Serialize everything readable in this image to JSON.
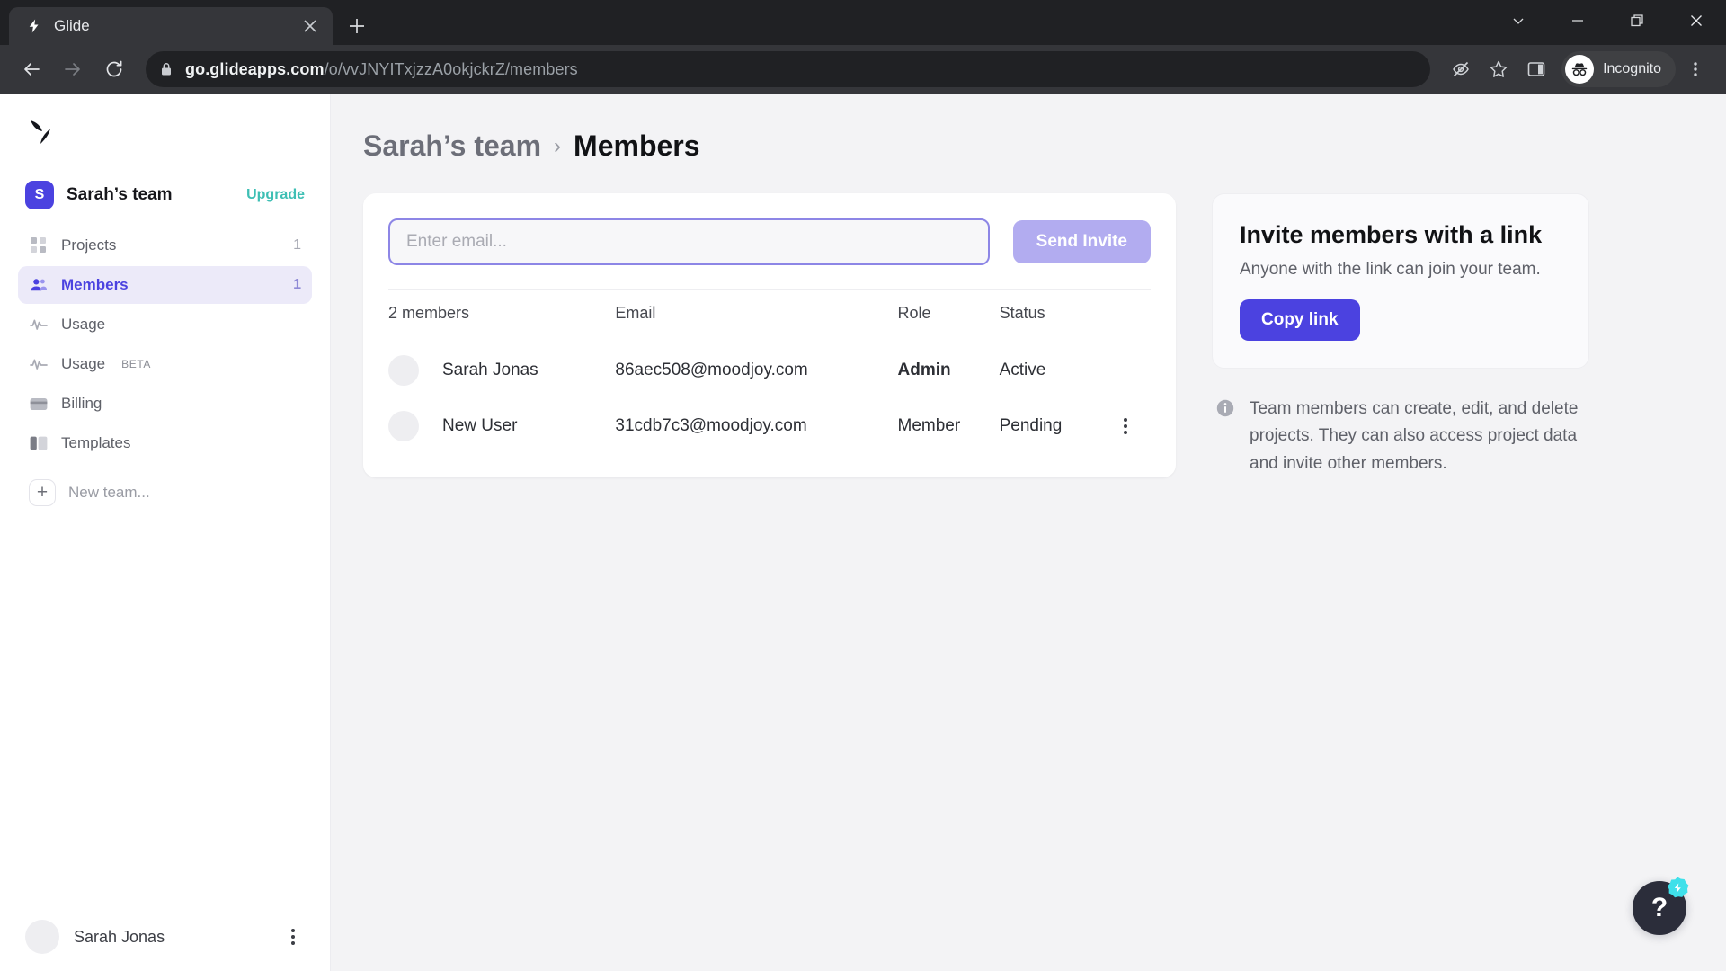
{
  "browser": {
    "tab": {
      "title": "Glide",
      "favicon_icon": "glide-bolt-icon",
      "close_icon": "close-icon"
    },
    "new_tab_icon": "plus-icon",
    "window_controls": [
      "chevron-down-icon",
      "minimize-icon",
      "restore-icon",
      "close-icon"
    ],
    "nav": {
      "back_icon": "back-arrow-icon",
      "forward_icon": "forward-arrow-icon",
      "reload_icon": "reload-icon"
    },
    "omnibox": {
      "lock_icon": "lock-icon",
      "url_host": "go.glideapps.com",
      "url_path": "/o/vvJNYITxjzzA0okjckrZ/members"
    },
    "toolbar_icons": [
      "eye-off-icon",
      "bookmark-star-icon",
      "side-panel-icon"
    ],
    "profile": {
      "label": "Incognito",
      "avatar_icon": "incognito-avatar-icon"
    },
    "menu_icon": "kebab-menu-icon"
  },
  "sidebar": {
    "logo_icon": "glide-logo-icon",
    "team": {
      "initial": "S",
      "name": "Sarah’s team",
      "upgrade_label": "Upgrade"
    },
    "items": [
      {
        "label": "Projects",
        "icon": "grid-icon",
        "count": "1",
        "active": false
      },
      {
        "label": "Members",
        "icon": "people-icon",
        "count": "1",
        "active": true
      },
      {
        "label": "Usage",
        "icon": "activity-icon",
        "count": "",
        "active": false
      },
      {
        "label": "Usage",
        "badge": "BETA",
        "icon": "activity-icon",
        "count": "",
        "active": false
      },
      {
        "label": "Billing",
        "icon": "credit-card-icon",
        "count": "",
        "active": false
      },
      {
        "label": "Templates",
        "icon": "templates-icon",
        "count": "",
        "active": false
      }
    ],
    "new_team": {
      "label": "New team...",
      "icon": "plus-icon"
    },
    "user": {
      "name": "Sarah Jonas",
      "avatar_icon": "avatar-icon",
      "menu_icon": "kebab-menu-icon"
    }
  },
  "main": {
    "breadcrumb": {
      "team": "Sarah’s team",
      "separator": "›",
      "current": "Members"
    },
    "invite": {
      "placeholder": "Enter email...",
      "value": "",
      "send_label": "Send Invite"
    },
    "table": {
      "headers": [
        "2 members",
        "Email",
        "Role",
        "Status",
        ""
      ],
      "rows": [
        {
          "name": "Sarah Jonas",
          "email": "86aec508@moodjoy.com",
          "role": "Admin",
          "status": "Active",
          "has_menu": false
        },
        {
          "name": "New User",
          "email": "31cdb7c3@moodjoy.com",
          "role": "Member",
          "status": "Pending",
          "has_menu": true
        }
      ]
    }
  },
  "side_panel": {
    "title": "Invite members with a link",
    "subtitle": "Anyone with the link can join your team.",
    "copy_label": "Copy link",
    "note_icon": "info-icon",
    "note": "Team members can create, edit, and delete projects. They can also access project data and invite other members."
  },
  "help": {
    "label": "?",
    "icon": "question-mark-icon",
    "badge_icon": "glide-spark-badge-icon"
  },
  "colors": {
    "accent": "#4b42e0",
    "accent_soft": "#b2acf0",
    "upgrade_teal": "#3ebfb4",
    "page_bg": "#f3f3f5",
    "chrome_bg": "#202124",
    "badge_cyan": "#3fe0ea"
  }
}
